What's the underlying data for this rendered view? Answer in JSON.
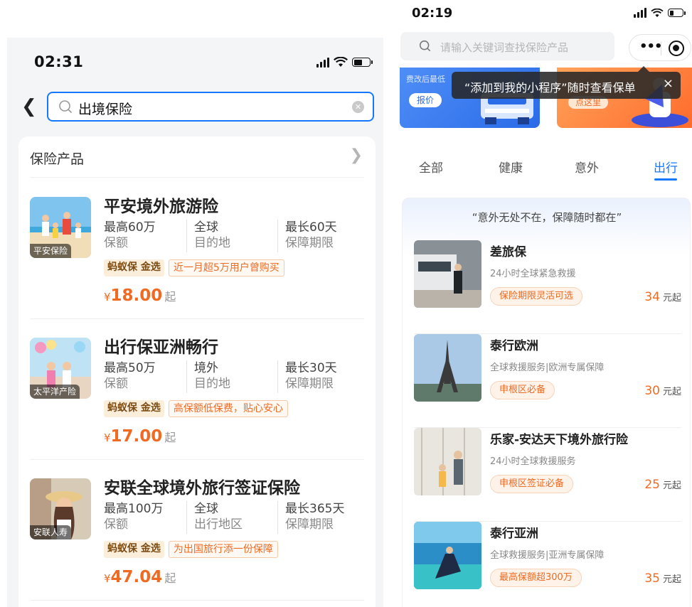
{
  "left": {
    "status": {
      "time": "02:31"
    },
    "search": {
      "query": "出境保险"
    },
    "section": {
      "title": "保险产品"
    },
    "products": [
      {
        "name": "平安境外旅游险",
        "insurer": "平安保险",
        "facts": [
          {
            "value": "最高60万",
            "label": "保额"
          },
          {
            "value": "全球",
            "label": "目的地"
          },
          {
            "value": "最长60天",
            "label": "保障期限"
          }
        ],
        "brand": "蚂蚁保 金选",
        "slogan": "近一月超5万用户曾购买",
        "currency": "¥",
        "price": "18.00",
        "price_suffix": "起"
      },
      {
        "name": "出行保亚洲畅行",
        "insurer": "太平洋产险",
        "facts": [
          {
            "value": "最高50万",
            "label": "保额"
          },
          {
            "value": "境外",
            "label": "目的地"
          },
          {
            "value": "最长30天",
            "label": "保障期限"
          }
        ],
        "brand": "蚂蚁保 金选",
        "slogan": "高保额低保费，贴心安心",
        "currency": "¥",
        "price": "17.00",
        "price_suffix": "起"
      },
      {
        "name": "安联全球境外旅行签证保险",
        "insurer": "安联人寿",
        "facts": [
          {
            "value": "最高100万",
            "label": "保额"
          },
          {
            "value": "全球",
            "label": "出行地区"
          },
          {
            "value": "最长365天",
            "label": "保障期限"
          }
        ],
        "brand": "蚂蚁保 金选",
        "slogan": "为出国旅行添一份保障",
        "currency": "¥",
        "price": "47.04",
        "price_suffix": "起"
      }
    ]
  },
  "right": {
    "status": {
      "time": "02:19"
    },
    "search": {
      "placeholder": "请输入关键词查找保险产品"
    },
    "capsule": {
      "more": "•••"
    },
    "banner": {
      "left_text": "费改后最低",
      "left_button": "报价",
      "right_button": "点这里"
    },
    "tooltip": {
      "text": "“添加到我的小程序”随时查看保单",
      "close": "×"
    },
    "tabs": [
      "全部",
      "健康",
      "意外",
      "出行"
    ],
    "active_tab": 3,
    "motto": "“意外无处不在，保障随时都在”",
    "items": [
      {
        "name": "差旅保",
        "desc": "24小时全球紧急救援",
        "badge": "保险期限灵活可选",
        "price": "34",
        "unit": "元起"
      },
      {
        "name": "泰行欧洲",
        "desc": "全球救援服务|欧洲专属保障",
        "badge": "申根区必备",
        "price": "30",
        "unit": "元起"
      },
      {
        "name": "乐家-安达天下境外旅行险",
        "desc": "24小时全球救援服务",
        "badge": "申根区签证必备",
        "price": "25",
        "unit": "元起"
      },
      {
        "name": "泰行亚洲",
        "desc": "全球救援服务|亚洲专属保障",
        "badge": "最高保额超300万",
        "price": "35",
        "unit": "元起"
      }
    ]
  },
  "colors": {
    "accent_blue": "#1677ff",
    "price_orange": "#ef6a22",
    "brand_gold_bg": "#fbefdc"
  }
}
